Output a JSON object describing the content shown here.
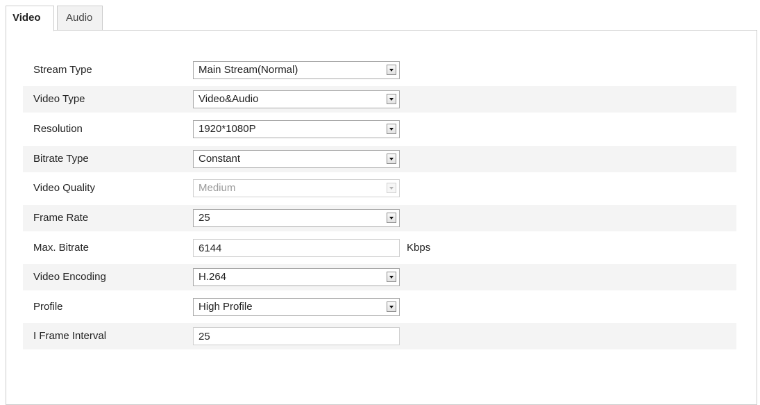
{
  "tabs": {
    "video": "Video",
    "audio": "Audio"
  },
  "form": {
    "stream_type": {
      "label": "Stream Type",
      "value": "Main Stream(Normal)"
    },
    "video_type": {
      "label": "Video Type",
      "value": "Video&Audio"
    },
    "resolution": {
      "label": "Resolution",
      "value": "1920*1080P"
    },
    "bitrate_type": {
      "label": "Bitrate Type",
      "value": "Constant"
    },
    "video_quality": {
      "label": "Video Quality",
      "value": "Medium",
      "disabled": true
    },
    "frame_rate": {
      "label": "Frame Rate",
      "value": "25"
    },
    "max_bitrate": {
      "label": "Max. Bitrate",
      "value": "6144",
      "unit": "Kbps"
    },
    "video_encoding": {
      "label": "Video Encoding",
      "value": "H.264"
    },
    "profile": {
      "label": "Profile",
      "value": "High Profile"
    },
    "i_frame_interval": {
      "label": "I Frame Interval",
      "value": "25"
    }
  },
  "icons": {
    "dropdown": "chevron-down-icon"
  },
  "colors": {
    "border": "#cccccc",
    "row_shade": "#f4f4f4",
    "disabled_text": "#9a9a9a"
  }
}
